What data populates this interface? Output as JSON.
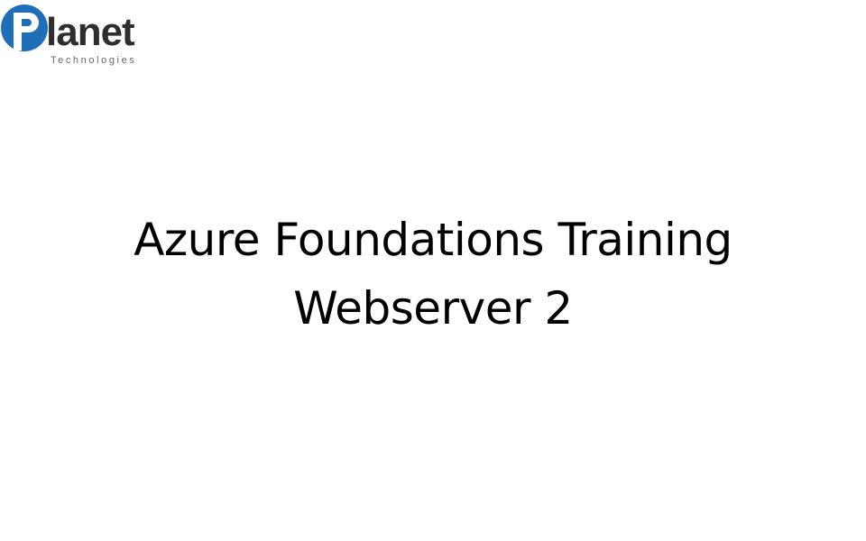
{
  "logo": {
    "brand_word": "lanet",
    "brand_initial": "P",
    "tagline": "Technologies",
    "colors": {
      "accent_blue": "#1f6fb8",
      "text_dark": "#2e2e2e",
      "tagline_gray": "#6a6a6a"
    }
  },
  "slide": {
    "title_line_1": "Azure Foundations Training",
    "title_line_2": "Webserver 2"
  }
}
